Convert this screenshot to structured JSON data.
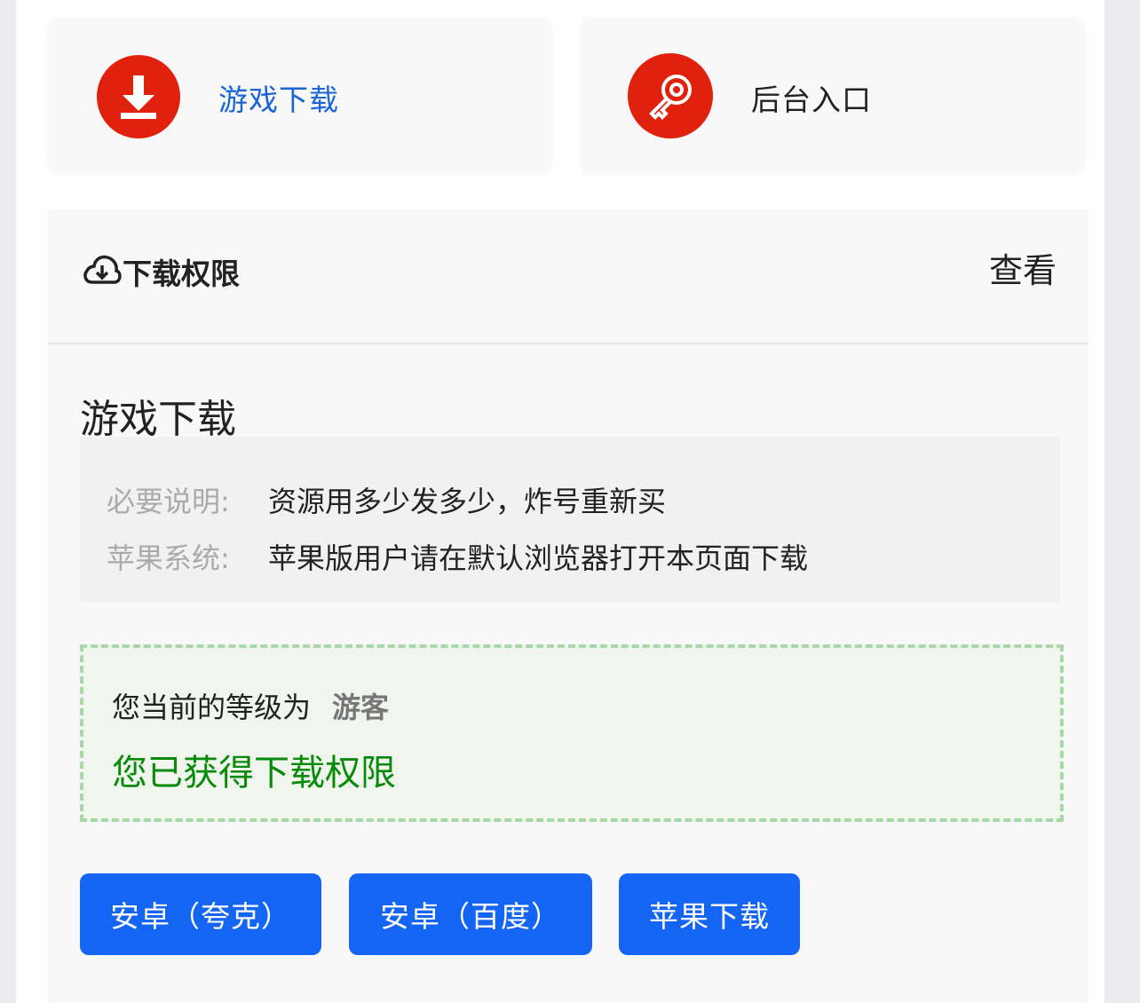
{
  "cards": {
    "download": {
      "label": "游戏下载",
      "icon": "download-icon"
    },
    "admin": {
      "label": "后台入口",
      "icon": "key-icon"
    }
  },
  "permission": {
    "icon": "cloud-download-icon",
    "title": "下载权限",
    "view_link": "查看"
  },
  "game_download": {
    "title": "游戏下载",
    "info": [
      {
        "key": "必要说明:",
        "value": "资源用多少发多少，炸号重新买"
      },
      {
        "key": "苹果系统:",
        "value": "苹果版用户请在默认浏览器打开本页面下载"
      }
    ],
    "level_prefix": "您当前的等级为",
    "level_value": "游客",
    "permission_granted": "您已获得下载权限",
    "buttons": [
      "安卓（夸克）",
      "安卓（百度）",
      "苹果下载"
    ]
  },
  "colors": {
    "brand_red": "#e0210e",
    "link_blue": "#1a64d8",
    "button_blue": "#1565f5",
    "success_green": "#0a8a0a",
    "dashed_green": "#a6d9a6"
  }
}
